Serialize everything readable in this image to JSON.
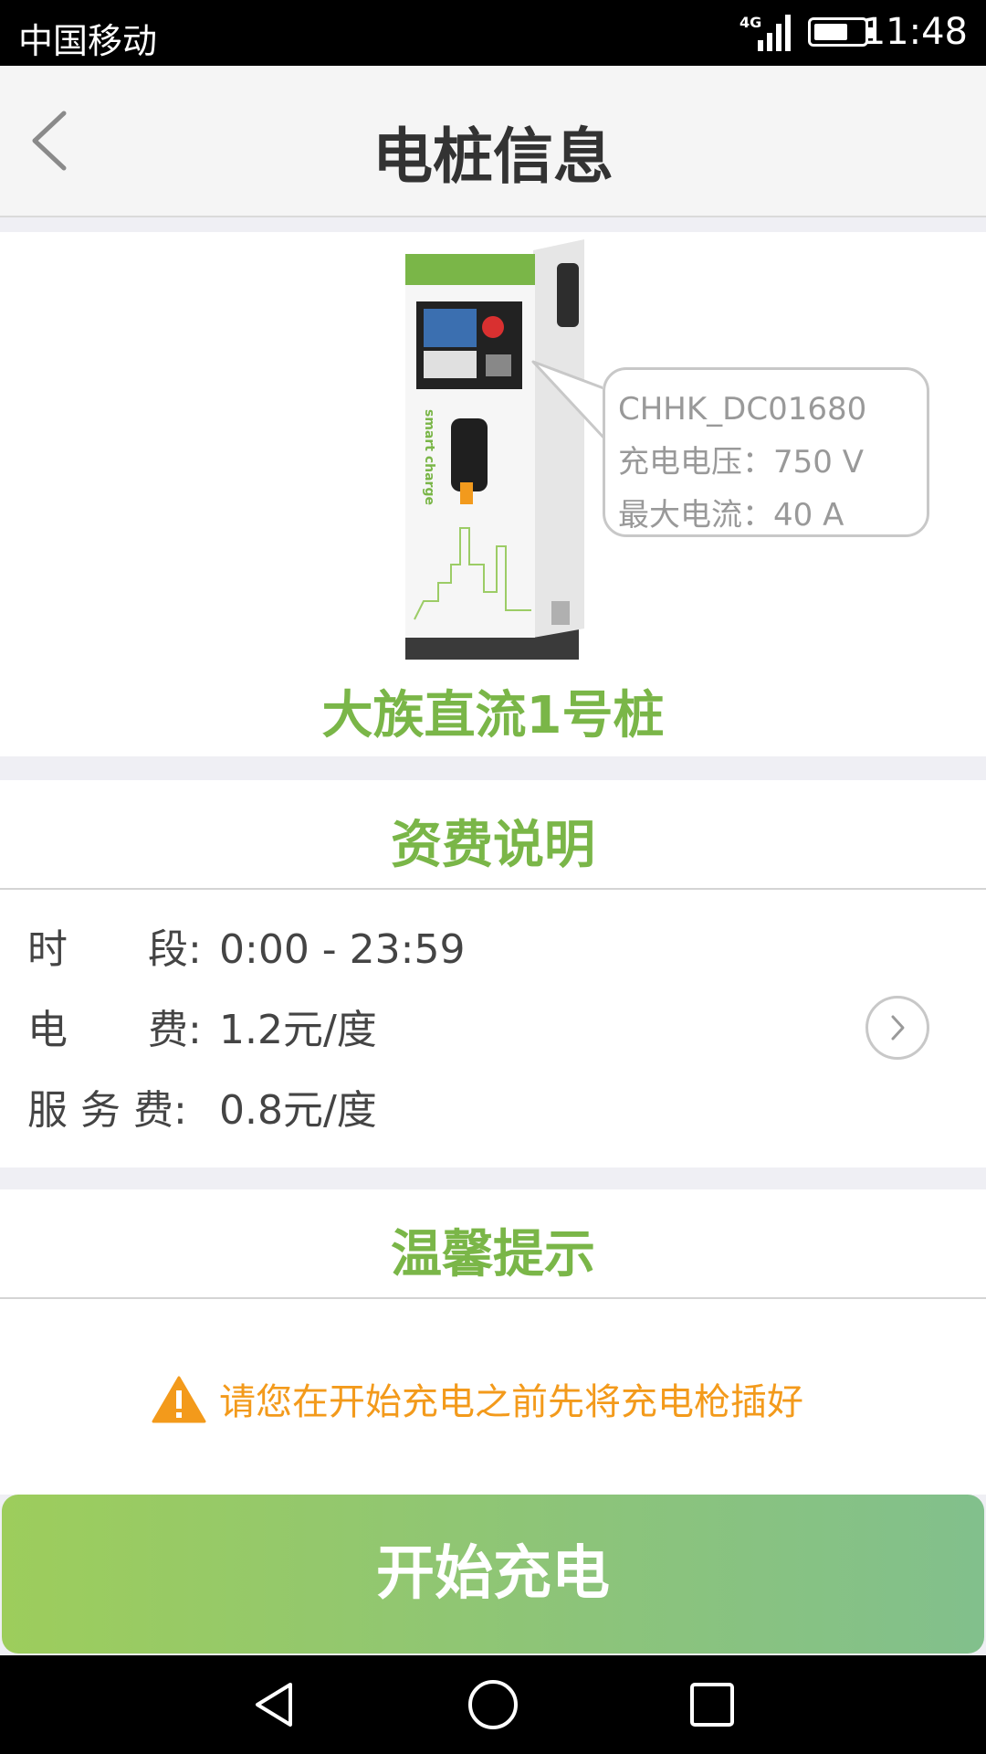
{
  "status_bar": {
    "carrier": "中国移动",
    "network": "4G",
    "time": "11:48"
  },
  "header": {
    "title": "电桩信息"
  },
  "pile": {
    "id": "CHHK_DC01680",
    "voltage": "充电电压：750 V",
    "current": "最大电流：40 A",
    "name": "大族直流1号桩",
    "image_text": "smart charge"
  },
  "fees": {
    "title": "资费说明",
    "rows": [
      {
        "label": "时　　段:",
        "value": "0:00 - 23:59"
      },
      {
        "label": "电　　费:",
        "value": "1.2元/度"
      },
      {
        "label": "服 务 费:",
        "value": "0.8元/度"
      }
    ]
  },
  "tips": {
    "title": "温馨提示",
    "message": "请您在开始充电之前先将充电枪插好"
  },
  "actions": {
    "start_label": "开始充电"
  },
  "colors": {
    "accent": "#7ab648",
    "warning": "#f39a1b",
    "button_start": "#9dcd5c",
    "button_end": "#82c08c"
  }
}
